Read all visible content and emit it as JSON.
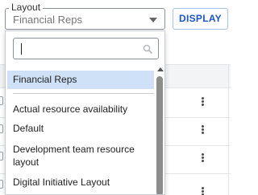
{
  "layout": {
    "label": "Layout",
    "value": "Financial Reps"
  },
  "toolbar": {
    "display_label": "DISPLAY"
  },
  "dropdown": {
    "search_value": "",
    "items": [
      {
        "label": "Financial Reps",
        "selected": true
      },
      {
        "label": "Actual resource availability",
        "selected": false
      },
      {
        "label": "Default",
        "selected": false
      },
      {
        "label": "Development team resource layout",
        "selected": false
      },
      {
        "label": "Digital Initiative Layout",
        "selected": false
      }
    ]
  },
  "colors": {
    "accent": "#1a55c4",
    "selected_bg": "#cfe1f7",
    "border": "#8b9099"
  },
  "icons": {
    "select_caret": "caret-down-icon",
    "search": "search-icon",
    "row_menu": "kebab-menu-icon"
  }
}
